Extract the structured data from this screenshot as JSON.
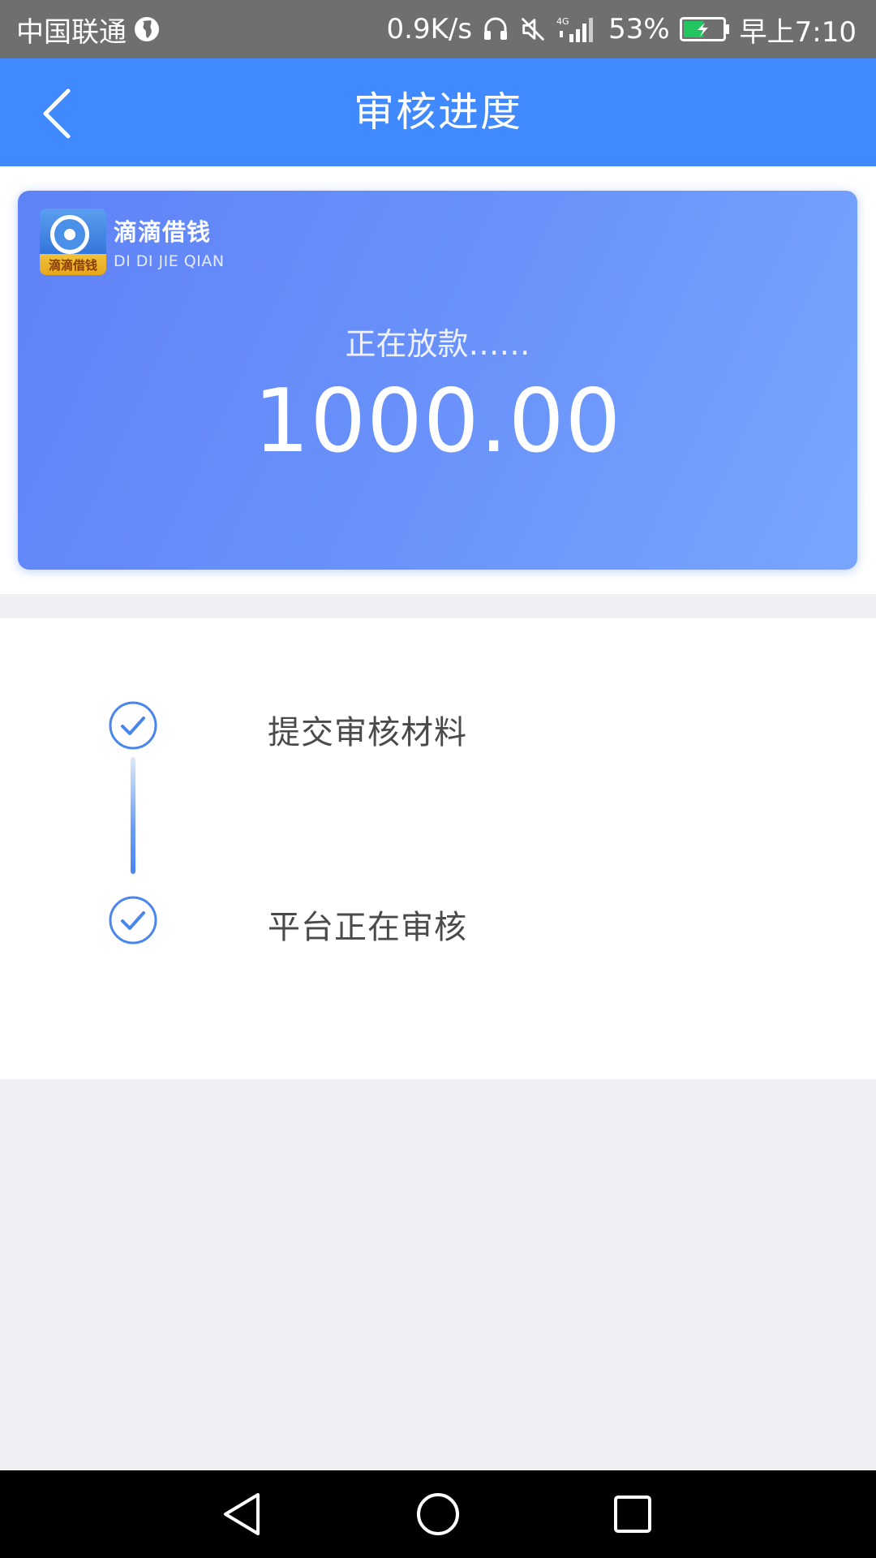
{
  "status_bar": {
    "carrier": "中国联通",
    "net_speed": "0.9K/s",
    "battery_percent": "53%",
    "time": "早上7:10",
    "icons": [
      "globe-icon",
      "headset-icon",
      "mute-icon",
      "signal-4g-icon",
      "battery-charging-icon"
    ],
    "battery_level": 0.53,
    "battery_color": "#22c55e"
  },
  "header": {
    "title": "审核进度",
    "back_icon": "chevron-left-icon",
    "background": "#4089ff"
  },
  "card": {
    "logo_text": "滴滴借钱",
    "brand_name": "滴滴借钱",
    "brand_pinyin": "DI DI JIE QIAN",
    "status": "正在放款……",
    "amount": "1000.00"
  },
  "progress": {
    "steps": [
      {
        "label": "提交审核材料",
        "icon": "check-circle-icon",
        "done": true
      },
      {
        "label": "平台正在审核",
        "icon": "check-circle-icon",
        "done": true
      }
    ],
    "accent_color": "#4a85ee"
  },
  "nav_bar": {
    "icons": [
      "nav-back-icon",
      "nav-home-icon",
      "nav-recent-icon"
    ]
  }
}
